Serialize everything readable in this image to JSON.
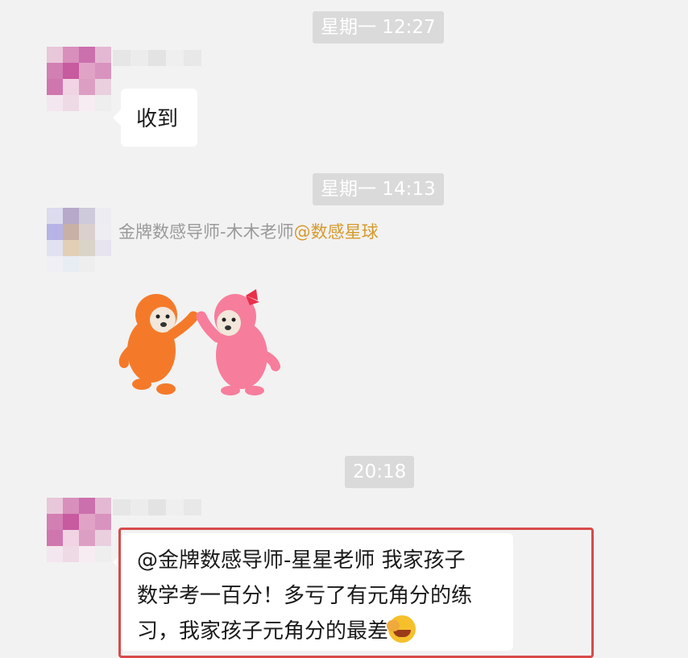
{
  "messages": [
    {
      "time": "星期一 12:27",
      "text": "收到"
    },
    {
      "time": "星期一 14:13",
      "sender_name": "金牌数感导师-木木老师",
      "sender_org": "@数感星球",
      "sticker": "high-five-sticker"
    },
    {
      "time": "20:18",
      "text": "@金牌数感导师-星星老师 我家孩子\n数学考一百分！多亏了有元角分的练\n习，我家孩子元角分的最差",
      "emoji": "face-palm-emoji"
    }
  ],
  "colors": {
    "background": "#f2f2f2",
    "timestamp_bg": "#dadada",
    "bubble": "#ffffff",
    "org_highlight": "#d59a2c",
    "highlight_border": "#d84a4a"
  }
}
